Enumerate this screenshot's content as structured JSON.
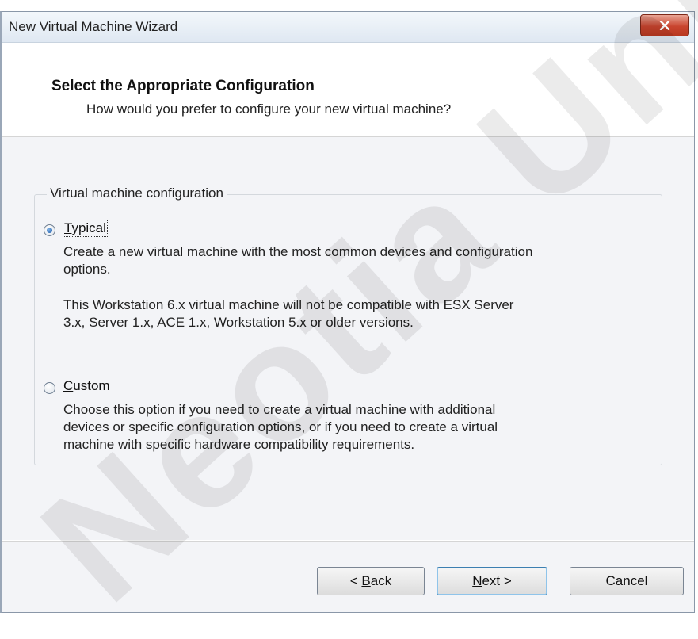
{
  "window": {
    "title": "New Virtual Machine Wizard"
  },
  "header": {
    "title": "Select the Appropriate Configuration",
    "subtitle": "How would you prefer to configure your new virtual machine?"
  },
  "group": {
    "legend": "Virtual machine configuration",
    "options": [
      {
        "key": "typical",
        "label": "Typical",
        "checked": true,
        "description_lines": [
          "Create a new virtual machine with the most common devices and configuration",
          "options."
        ],
        "note_lines": [
          "This Workstation 6.x virtual machine will not be compatible with ESX Server",
          "3.x, Server 1.x, ACE 1.x, Workstation 5.x or older versions."
        ]
      },
      {
        "key": "custom",
        "label": "Custom",
        "checked": false,
        "description_lines": [
          "Choose this option if you need to create a virtual machine with additional",
          "devices or specific configuration options, or if you need to create a virtual",
          "machine with specific hardware compatibility requirements."
        ]
      }
    ]
  },
  "buttons": {
    "back_prefix": "< ",
    "back_mnemonic": "B",
    "back_rest": "ack",
    "next_mnemonic": "N",
    "next_rest": "ext >",
    "cancel": "Cancel"
  },
  "watermark": "Neotia Uni",
  "icons": {
    "close": "close-icon",
    "radio_checked": "radio-checked-icon",
    "radio_unchecked": "radio-unchecked-icon"
  },
  "colors": {
    "close_button": "#c9452f",
    "body_background": "#f3f4f7",
    "default_button_border": "#3c7fb1"
  }
}
